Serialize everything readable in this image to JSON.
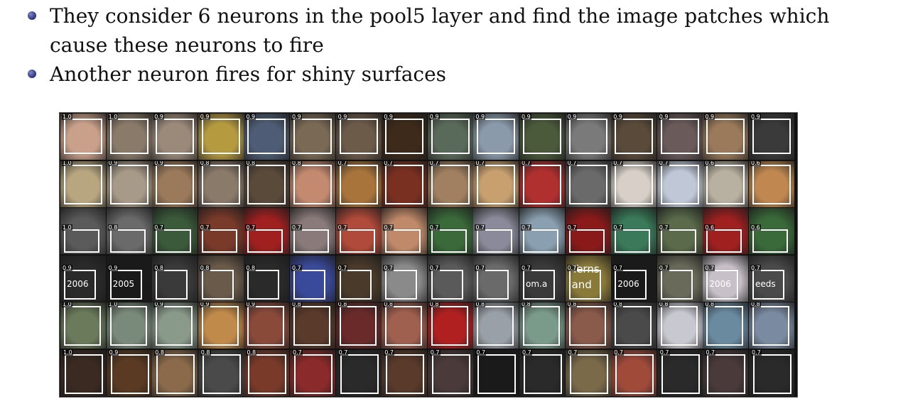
{
  "bullets": [
    {
      "text": "They consider 6 neurons in the pool5 layer and find the image patches which cause these neurons to fire"
    },
    {
      "text": "Another neuron fires for shiny surfaces"
    }
  ],
  "figure": {
    "rows": [
      {
        "scores": [
          "1.0",
          "1.0",
          "0.9",
          "0.9",
          "0.9",
          "0.9",
          "0.9",
          "0.9",
          "0.9",
          "0.9",
          "0.9",
          "0.9",
          "0.9",
          "0.9",
          "0.9",
          "0.9"
        ],
        "colors": [
          "#c9a08a",
          "#8a7a6a",
          "#9b8a7a",
          "#b59a40",
          "#4e5d75",
          "#7a6a55",
          "#6d5b4a",
          "#3d2a1a",
          "#5a6a5a",
          "#8a9aaa",
          "#4a5a3a",
          "#7a7a7a",
          "#5a4a3a",
          "#6a5a5a",
          "#9a7a5a",
          "#3a3a3a"
        ],
        "texts": [
          "",
          "",
          "",
          "",
          "",
          "",
          "",
          "",
          "",
          "",
          "",
          "",
          "",
          "",
          "",
          ""
        ]
      },
      {
        "scores": [
          "1.0",
          "0.9",
          "0.9",
          "0.8",
          "0.8",
          "0.8",
          "0.7",
          "0.7",
          "0.7",
          "0.7",
          "0.7",
          "0.7",
          "0.7",
          "0.7",
          "0.6",
          "0.6"
        ],
        "colors": [
          "#b8a680",
          "#a89a88",
          "#9a7a5a",
          "#8a7a6a",
          "#5a4a3a",
          "#c48a70",
          "#a8743c",
          "#7a3020",
          "#a08060",
          "#c8a070",
          "#b03030",
          "#6a6a6a",
          "#d8d0c8",
          "#c0c8d8",
          "#b8b0a0",
          "#c08850"
        ],
        "texts": [
          "",
          "",
          "",
          "",
          "",
          "",
          "",
          "",
          "",
          "",
          "",
          "",
          "",
          "",
          "",
          ""
        ]
      },
      {
        "scores": [
          "1.0",
          "0.8",
          "0.7",
          "0.7",
          "0.7",
          "0.7",
          "0.7",
          "0.7",
          "0.7",
          "0.7",
          "0.7",
          "0.7",
          "0.7",
          "0.7",
          "0.6",
          "0.6"
        ],
        "colors": [
          "#5a5a5a",
          "#6a6a6a",
          "#3a5a3a",
          "#7a3a2a",
          "#a02020",
          "#8a7a7a",
          "#b04a3a",
          "#c08a6a",
          "#3a6a3a",
          "#8a8a9a",
          "#8aa0b0",
          "#8a1a1a",
          "#3a7a5a",
          "#5a6a4a",
          "#a02020",
          "#3a6a3a"
        ],
        "texts": [
          "",
          "",
          "",
          "",
          "",
          "",
          "",
          "",
          "",
          "",
          "",
          "",
          "",
          "",
          "",
          ""
        ]
      },
      {
        "scores": [
          "0.9",
          "0.9",
          "0.8",
          "0.8",
          "0.8",
          "0.7",
          "0.7",
          "0.7",
          "0.7",
          "0.7",
          "0.7",
          "0.7",
          "0.7",
          "0.7",
          "0.7",
          "0.7"
        ],
        "colors": [
          "#2a2a2a",
          "#1a1a1a",
          "#3a3a3a",
          "#6a5a4a",
          "#2a2a2a",
          "#3a4a9a",
          "#4a3a2a",
          "#8a8a8a",
          "#5a5a5a",
          "#6a6a6a",
          "#3a3a3a",
          "#8a7a3a",
          "#1a1a1a",
          "#6a6a5a",
          "#c8c0c8",
          "#4a4a4a"
        ],
        "texts": [
          "2006",
          "2005",
          "",
          "",
          "",
          "",
          "",
          "",
          "",
          "",
          "om.a",
          "Terns and",
          "2006",
          "",
          "2006",
          "eeds"
        ]
      },
      {
        "scores": [
          "1.0",
          "1.0",
          "0.9",
          "0.9",
          "0.9",
          "0.8",
          "0.8",
          "0.8",
          "0.8",
          "0.8",
          "0.8",
          "0.8",
          "0.8",
          "0.8",
          "0.8",
          "0.8"
        ],
        "colors": [
          "#6a7a5a",
          "#7a8a7a",
          "#8a9a8a",
          "#c08a4a",
          "#8a4a3a",
          "#5a3a2a",
          "#6a2a2a",
          "#a06050",
          "#b02020",
          "#9aa0a8",
          "#7a9a8a",
          "#8a5a4a",
          "#4a4a4a",
          "#c8c8d0",
          "#6a8aa0",
          "#7a8aa0"
        ],
        "texts": [
          "",
          "",
          "",
          "",
          "",
          "",
          "",
          "",
          "",
          "",
          "",
          "",
          "",
          "",
          "",
          ""
        ]
      },
      {
        "scores": [
          "1.0",
          "0.9",
          "0.8",
          "0.8",
          "0.8",
          "0.7",
          "0.7",
          "0.7",
          "0.7",
          "0.7",
          "0.7",
          "0.7",
          "0.7",
          "0.7",
          "0.7",
          "0.7"
        ],
        "colors": [
          "#3a2a22",
          "#5a3a22",
          "#8a6a4a",
          "#4a4a4a",
          "#7a3a2a",
          "#8a2a2a",
          "#2a2a2a",
          "#5a3a2a",
          "#4a3a3a",
          "#1a1a1a",
          "#2a2a2a",
          "#7a6a4a",
          "#a04a3a",
          "#2a2a2a",
          "#4a3a3a",
          "#2a2a2a"
        ],
        "texts": [
          "",
          "",
          "",
          "",
          "",
          "",
          "",
          "",
          "",
          "",
          "",
          "",
          "",
          "",
          "",
          ""
        ]
      }
    ]
  }
}
